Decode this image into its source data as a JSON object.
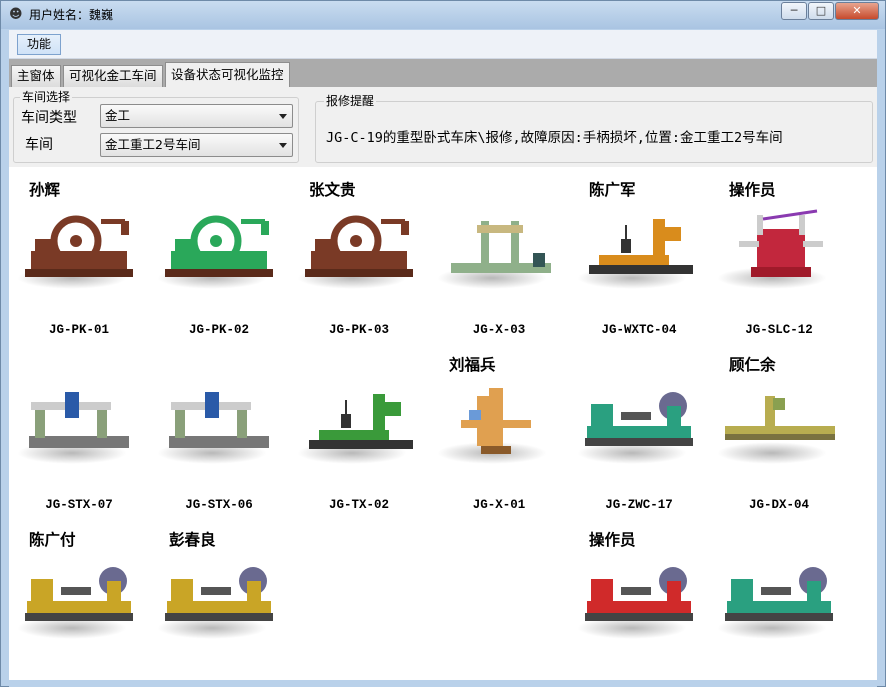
{
  "window": {
    "title": "用户姓名：魏巍",
    "minimize": "─",
    "maximize": "□",
    "close": "✕",
    "icon": "user-icon"
  },
  "menu": {
    "function_label": "功能"
  },
  "tabs": [
    {
      "label": "主窗体"
    },
    {
      "label": "可视化金工车间"
    },
    {
      "label": "设备状态可视化监控"
    }
  ],
  "workshop_select": {
    "group_label": "车间选择",
    "type_label": "车间类型",
    "type_value": "金工",
    "shop_label": "车间",
    "shop_value": "金工重工2号车间"
  },
  "repair_notice": {
    "group_label": "报修提醒",
    "text": "JG-C-19的重型卧式车床\\报修,故障原因:手柄损坏,位置:金工重工2号车间"
  },
  "machines": [
    {
      "operator": "孙辉",
      "code": "JG-PK-01",
      "kind": "gear",
      "color": "#7a3a26"
    },
    {
      "operator": "",
      "code": "JG-PK-02",
      "kind": "gear",
      "color": "#2aa85a"
    },
    {
      "operator": "张文贵",
      "code": "JG-PK-03",
      "kind": "gear",
      "color": "#7a3a26"
    },
    {
      "operator": "",
      "code": "JG-X-03",
      "kind": "planer",
      "color": "#8fb08a"
    },
    {
      "operator": "陈广军",
      "code": "JG-WXTC-04",
      "kind": "boring",
      "color": "#d98c1c"
    },
    {
      "operator": "操作员",
      "code": "JG-SLC-12",
      "kind": "vlathe",
      "color": "#c2273d"
    },
    {
      "operator": "",
      "code": "JG-STX-07",
      "kind": "gantry",
      "color": "#8aa07a"
    },
    {
      "operator": "",
      "code": "JG-STX-06",
      "kind": "gantry",
      "color": "#8aa07a"
    },
    {
      "operator": "",
      "code": "JG-TX-02",
      "kind": "boring",
      "color": "#3a9a3a"
    },
    {
      "operator": "刘福兵",
      "code": "JG-X-01",
      "kind": "mill",
      "color": "#e0a050"
    },
    {
      "operator": "",
      "code": "JG-ZWC-17",
      "kind": "lathe",
      "color": "#2aa080"
    },
    {
      "operator": "顾仁余",
      "code": "JG-DX-04",
      "kind": "bed",
      "color": "#b8ad50"
    },
    {
      "operator": "陈广付",
      "code": "",
      "kind": "lathe",
      "color": "#c9a526"
    },
    {
      "operator": "彭春良",
      "code": "",
      "kind": "lathe",
      "color": "#c9a526"
    },
    {
      "operator": "操作员",
      "code": "",
      "kind": "lathe",
      "color": "#d02a2a"
    },
    {
      "operator": "",
      "code": "",
      "kind": "lathe",
      "color": "#2aa080"
    }
  ]
}
